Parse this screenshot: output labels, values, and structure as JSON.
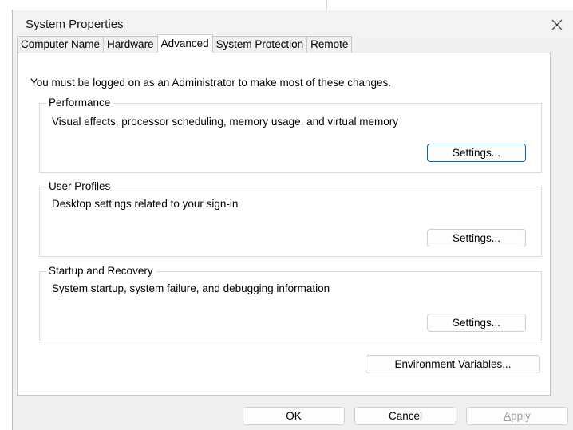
{
  "window": {
    "title": "System Properties",
    "close_glyph": "✕"
  },
  "tabs": [
    {
      "label": "Computer Name",
      "active": false
    },
    {
      "label": "Hardware",
      "active": false
    },
    {
      "label": "Advanced",
      "active": true
    },
    {
      "label": "System Protection",
      "active": false
    },
    {
      "label": "Remote",
      "active": false
    }
  ],
  "advanced": {
    "intro": "You must be logged on as an Administrator to make most of these changes.",
    "performance": {
      "title": "Performance",
      "description": "Visual effects, processor scheduling, memory usage, and virtual memory",
      "button": "Settings..."
    },
    "user_profiles": {
      "title": "User Profiles",
      "description": "Desktop settings related to your sign-in",
      "button": "Settings..."
    },
    "startup_recovery": {
      "title": "Startup and Recovery",
      "description": "System startup, system failure, and debugging information",
      "button": "Settings..."
    },
    "env_button": "Environment Variables..."
  },
  "footer": {
    "ok": "OK",
    "cancel": "Cancel",
    "apply_accel": "A",
    "apply_rest": "pply"
  },
  "colors": {
    "accent_border": "#0067c0",
    "disabled_text": "#a0a0a0"
  },
  "icons": {
    "close": "close-icon"
  }
}
